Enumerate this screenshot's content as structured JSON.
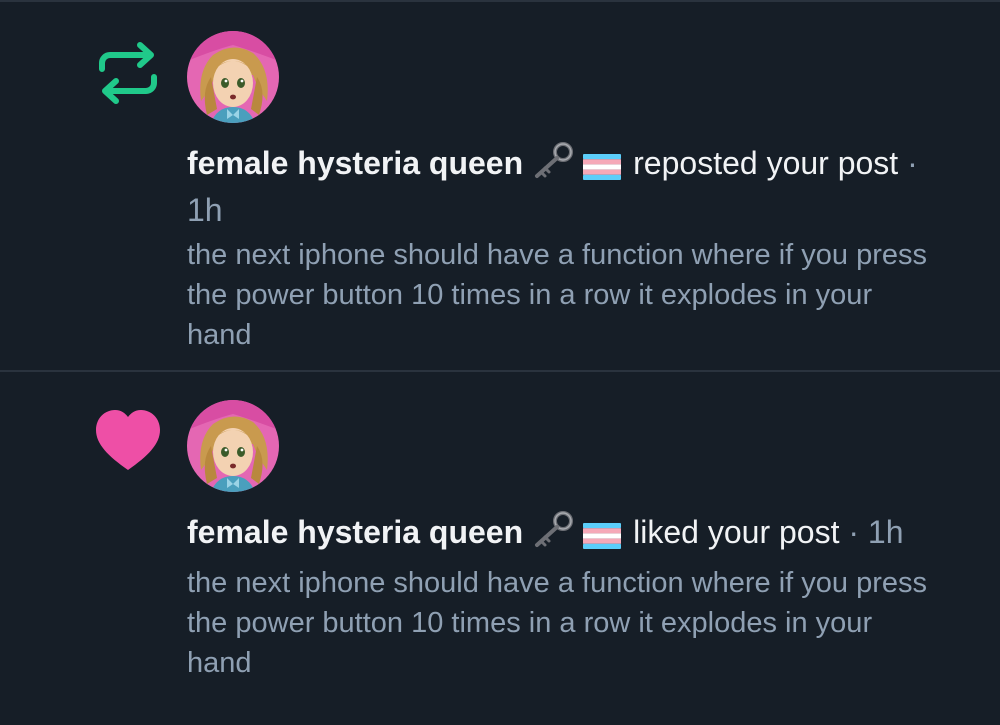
{
  "notifications": [
    {
      "type": "repost",
      "type_icon": "repost-icon",
      "icon_color": "#20c98a",
      "author": "female hysteria queen",
      "author_emojis": [
        "old-key-emoji",
        "transgender-flag-emoji"
      ],
      "action": "reposted your post",
      "separator": "·",
      "time": "1h",
      "post_text": "the next iphone should have a function where if you press the power button 10 times in a row it explodes in your hand"
    },
    {
      "type": "like",
      "type_icon": "heart-icon",
      "icon_color": "#ee4fa6",
      "author": "female hysteria queen",
      "author_emojis": [
        "old-key-emoji",
        "transgender-flag-emoji"
      ],
      "action": "liked your post",
      "separator": "·",
      "time": "1h",
      "post_text": "the next iphone should have a function where if you press the power button 10 times in a row it explodes in your hand"
    }
  ],
  "colors": {
    "background": "#161e27",
    "divider": "#2a333e",
    "primary_text": "#f1f3f5",
    "secondary_text": "#8fa0b3"
  }
}
